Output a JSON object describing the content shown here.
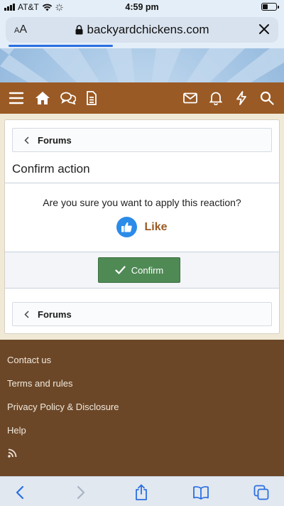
{
  "status_bar": {
    "carrier": "AT&T",
    "time": "4:59 pm",
    "battery_level": 0.35
  },
  "browser": {
    "aa_label_small": "A",
    "aa_label_large": "A",
    "url": "backyardchickens.com",
    "load_progress": 0.39
  },
  "nav": {
    "icons": [
      "menu-icon",
      "home-icon",
      "forums-chat-icon",
      "whats-new-document-icon",
      "inbox-envelope-icon",
      "alerts-bell-icon",
      "lightning-icon",
      "search-icon"
    ],
    "background": "#9a5a25"
  },
  "breadcrumb": {
    "label": "Forums"
  },
  "page": {
    "title": "Confirm action",
    "question": "Are you sure you want to apply this reaction?",
    "reaction_label": "Like",
    "confirm_label": "Confirm"
  },
  "footer": {
    "links": [
      "Contact us",
      "Terms and rules",
      "Privacy Policy & Disclosure",
      "Help"
    ],
    "rss_icon": "rss-icon"
  },
  "colors": {
    "brand_brown": "#9a5a25",
    "footer_brown": "#6b4728",
    "confirm_green": "#4f8a55",
    "like_blue": "#2b8be8",
    "ios_blue": "#2a6fe0"
  }
}
